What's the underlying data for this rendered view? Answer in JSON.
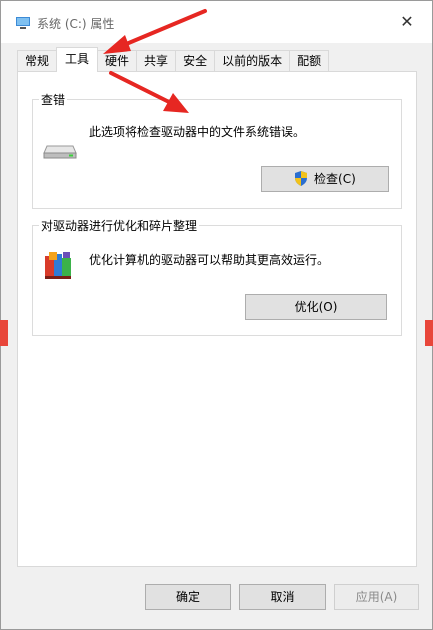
{
  "window": {
    "title": "系统 (C:) 属性",
    "close_symbol": "✕"
  },
  "tabs": [
    {
      "label": "常规",
      "active": false
    },
    {
      "label": "工具",
      "active": true
    },
    {
      "label": "硬件",
      "active": false
    },
    {
      "label": "共享",
      "active": false
    },
    {
      "label": "安全",
      "active": false
    },
    {
      "label": "以前的版本",
      "active": false
    },
    {
      "label": "配额",
      "active": false
    }
  ],
  "check_group": {
    "title": "查错",
    "description": "此选项将检查驱动器中的文件系统错误。",
    "button_label": "检查(C)",
    "drive_icon": "hard-drive-icon",
    "button_icon": "uac-shield-icon"
  },
  "optimize_group": {
    "title": "对驱动器进行优化和碎片整理",
    "description": "优化计算机的驱动器可以帮助其更高效运行。",
    "button_label": "优化(O)",
    "icon": "defrag-icon"
  },
  "footer": {
    "ok_label": "确定",
    "cancel_label": "取消",
    "apply_label": "应用(A)"
  },
  "annotation_color": "#e62722"
}
